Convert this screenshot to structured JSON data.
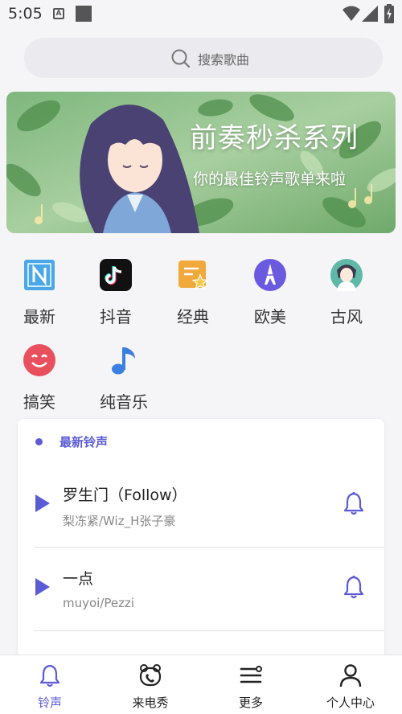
{
  "status": {
    "time": "5:05",
    "notif_letter": "A"
  },
  "search": {
    "placeholder": "搜索歌曲"
  },
  "banner": {
    "title": "前奏秒杀系列",
    "subtitle": "你的最佳铃声歌单来啦"
  },
  "categories": [
    {
      "label": "最新",
      "icon": "n-icon",
      "color": "#4aa8e8"
    },
    {
      "label": "抖音",
      "icon": "tiktok-icon",
      "color": "#111111"
    },
    {
      "label": "经典",
      "icon": "star-badge-icon",
      "color": "#f2a93b"
    },
    {
      "label": "欧美",
      "icon": "eiffel-tower-icon",
      "color": "#6a5ae0"
    },
    {
      "label": "古风",
      "icon": "ancient-portrait-icon",
      "color": "#5fb8a8"
    },
    {
      "label": "搞笑",
      "icon": "smile-face-icon",
      "color": "#e9505d"
    },
    {
      "label": "纯音乐",
      "icon": "music-note-icon",
      "color": "#3b7fe0"
    }
  ],
  "latest": {
    "header": "最新铃声",
    "songs": [
      {
        "title": "罗生门（Follow）",
        "artist": "梨冻紧/Wiz_H张子豪"
      },
      {
        "title": "一点",
        "artist": "muyoi/Pezzi"
      }
    ]
  },
  "nav": [
    {
      "label": "铃声",
      "icon": "bell-icon",
      "active": true
    },
    {
      "label": "来电秀",
      "icon": "phone-bear-icon",
      "active": false
    },
    {
      "label": "更多",
      "icon": "menu-icon",
      "active": false
    },
    {
      "label": "个人中心",
      "icon": "person-icon",
      "active": false
    }
  ],
  "colors": {
    "accent": "#5b5bd6",
    "background": "#f5f5f7"
  }
}
